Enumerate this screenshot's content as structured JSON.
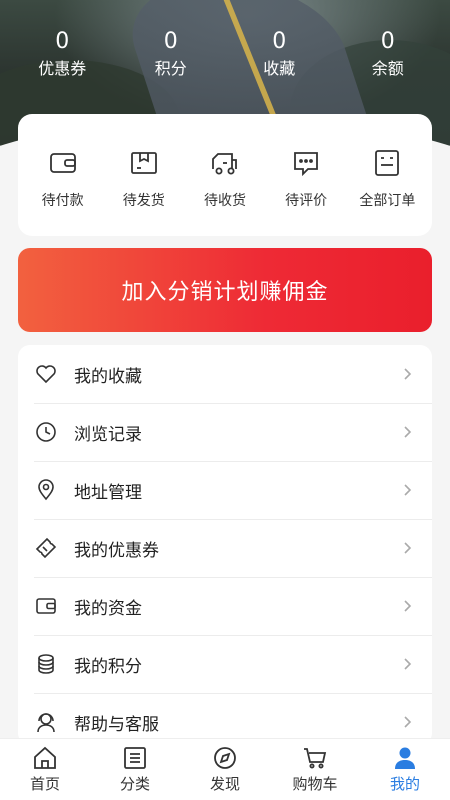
{
  "stats": [
    {
      "value": "0",
      "label": "优惠券"
    },
    {
      "value": "0",
      "label": "积分"
    },
    {
      "value": "0",
      "label": "收藏"
    },
    {
      "value": "0",
      "label": "余额"
    }
  ],
  "orders": [
    {
      "label": "待付款",
      "icon": "wallet-icon"
    },
    {
      "label": "待发货",
      "icon": "package-icon"
    },
    {
      "label": "待收货",
      "icon": "truck-icon"
    },
    {
      "label": "待评价",
      "icon": "comment-icon"
    },
    {
      "label": "全部订单",
      "icon": "order-list-icon"
    }
  ],
  "banner": {
    "label": "加入分销计划赚佣金",
    "colors": [
      "#f2613f",
      "#ea1f2c"
    ]
  },
  "menu": [
    {
      "label": "我的收藏",
      "icon": "heart-icon"
    },
    {
      "label": "浏览记录",
      "icon": "clock-icon"
    },
    {
      "label": "地址管理",
      "icon": "location-icon"
    },
    {
      "label": "我的优惠券",
      "icon": "coupon-icon"
    },
    {
      "label": "我的资金",
      "icon": "wallet-icon"
    },
    {
      "label": "我的积分",
      "icon": "coins-icon"
    },
    {
      "label": "帮助与客服",
      "icon": "support-icon"
    }
  ],
  "tabs": [
    {
      "label": "首页",
      "icon": "home-icon",
      "active": false
    },
    {
      "label": "分类",
      "icon": "category-icon",
      "active": false
    },
    {
      "label": "发现",
      "icon": "discover-icon",
      "active": false
    },
    {
      "label": "购物车",
      "icon": "cart-icon",
      "active": false
    },
    {
      "label": "我的",
      "icon": "user-icon",
      "active": true
    }
  ],
  "accent_color": "#2a7de1"
}
